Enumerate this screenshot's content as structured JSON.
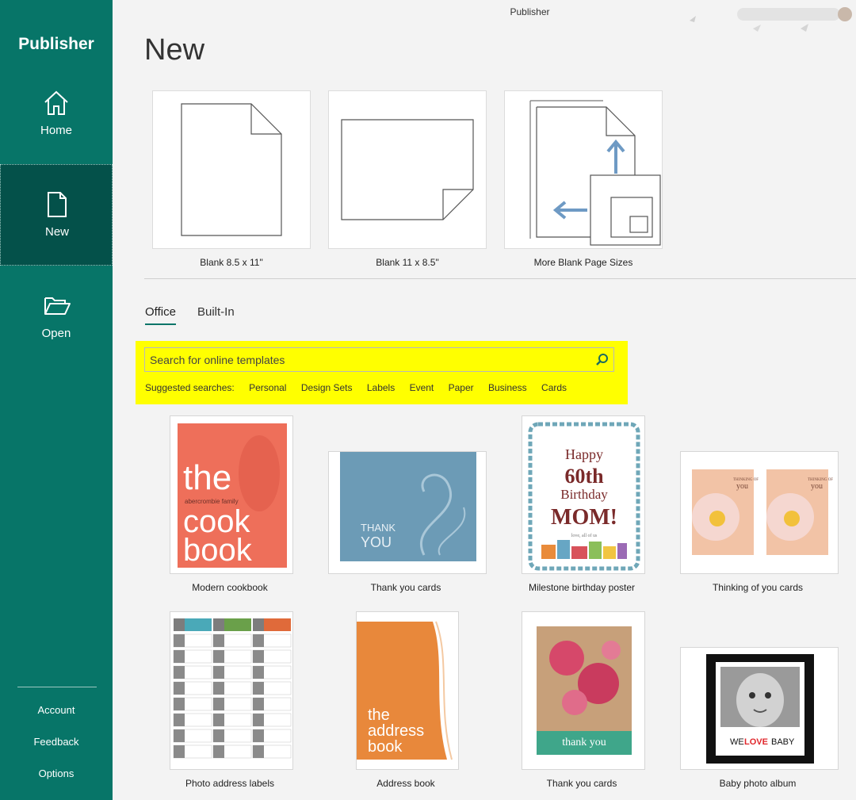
{
  "app": {
    "name": "Publisher",
    "window_title": "Publisher"
  },
  "nav": {
    "home": "Home",
    "new": "New",
    "open": "Open",
    "account": "Account",
    "feedback": "Feedback",
    "options": "Options"
  },
  "page": {
    "title": "New"
  },
  "blanks": [
    {
      "label": "Blank 8.5 x 11\""
    },
    {
      "label": "Blank 11 x 8.5\""
    },
    {
      "label": "More Blank Page Sizes"
    }
  ],
  "tabs": [
    {
      "label": "Office",
      "active": true
    },
    {
      "label": "Built-In",
      "active": false
    }
  ],
  "search": {
    "placeholder": "Search for online templates",
    "suggested_label": "Suggested searches:",
    "suggestions": [
      "Personal",
      "Design Sets",
      "Labels",
      "Event",
      "Paper",
      "Business",
      "Cards"
    ]
  },
  "templates": [
    {
      "label": "Modern cookbook",
      "thumb_text": [
        "the",
        "abercrombie family",
        "cook",
        "book"
      ]
    },
    {
      "label": "Thank you cards",
      "thumb_text": [
        "THANK",
        "YOU"
      ]
    },
    {
      "label": "Milestone birthday poster",
      "thumb_text": [
        "Happy",
        "60th",
        "Birthday",
        "MOM!",
        "love, all of us"
      ]
    },
    {
      "label": "Thinking of you cards",
      "thumb_text": [
        "THINKING OF",
        "you"
      ]
    },
    {
      "label": "Photo address labels"
    },
    {
      "label": "Address book",
      "thumb_text": [
        "the",
        "address",
        "book"
      ]
    },
    {
      "label": "Thank you cards",
      "thumb_text": [
        "thank you"
      ]
    },
    {
      "label": "Baby photo album",
      "thumb_text": [
        "WE",
        "LOVE",
        "BABY"
      ]
    }
  ],
  "colors": {
    "brand": "#077568",
    "brand_dark": "#04514a",
    "highlight": "#ffff00"
  }
}
